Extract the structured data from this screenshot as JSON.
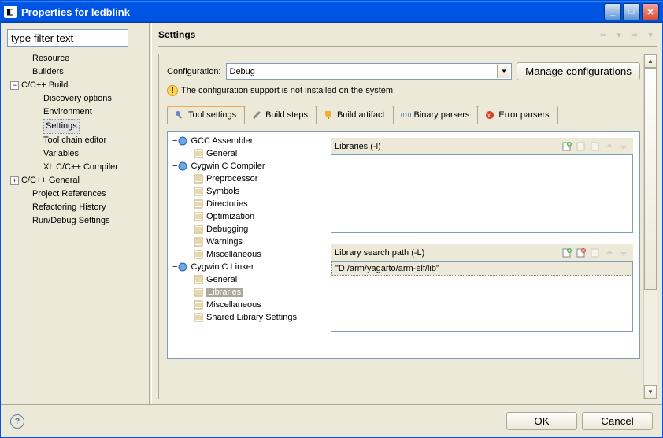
{
  "window": {
    "title": "Properties for ledblink"
  },
  "left": {
    "filter_placeholder": "type filter text",
    "nav": {
      "resource": "Resource",
      "builders": "Builders",
      "ccbuild": "C/C++ Build",
      "discovery": "Discovery options",
      "environment": "Environment",
      "settings": "Settings",
      "toolchain": "Tool chain editor",
      "variables": "Variables",
      "xlcompiler": "XL C/C++ Compiler",
      "ccgeneral": "C/C++ General",
      "projrefs": "Project References",
      "refactor": "Refactoring History",
      "rundebug": "Run/Debug Settings"
    }
  },
  "header": {
    "title": "Settings"
  },
  "config": {
    "label": "Configuration:",
    "value": "Debug",
    "manage_btn": "Manage configurations"
  },
  "warning": "The configuration support is not installed on the system",
  "tabs": {
    "tool_settings": "Tool settings",
    "build_steps": "Build steps",
    "build_artifact": "Build artifact",
    "binary_parsers": "Binary parsers",
    "error_parsers": "Error parsers"
  },
  "tool_tree": {
    "gcc_asm": "GCC Assembler",
    "general": "General",
    "cyg_cc": "Cygwin C Compiler",
    "preproc": "Preprocessor",
    "symbols": "Symbols",
    "directories": "Directories",
    "optimization": "Optimization",
    "debugging": "Debugging",
    "warnings": "Warnings",
    "misc": "Miscellaneous",
    "cyg_linker": "Cygwin C Linker",
    "linker_general": "General",
    "linker_libs": "Libraries",
    "linker_misc": "Miscellaneous",
    "linker_shared": "Shared Library Settings"
  },
  "libraries": {
    "label": "Libraries (-l)",
    "searchpath_label": "Library search path (-L)",
    "searchpath_items": [
      "\"D:/arm/yagarto/arm-elf/lib\""
    ]
  },
  "buttons": {
    "ok": "OK",
    "cancel": "Cancel"
  },
  "icons": {
    "expand_minus": "−",
    "expand_plus": "+"
  },
  "chart_data": null
}
